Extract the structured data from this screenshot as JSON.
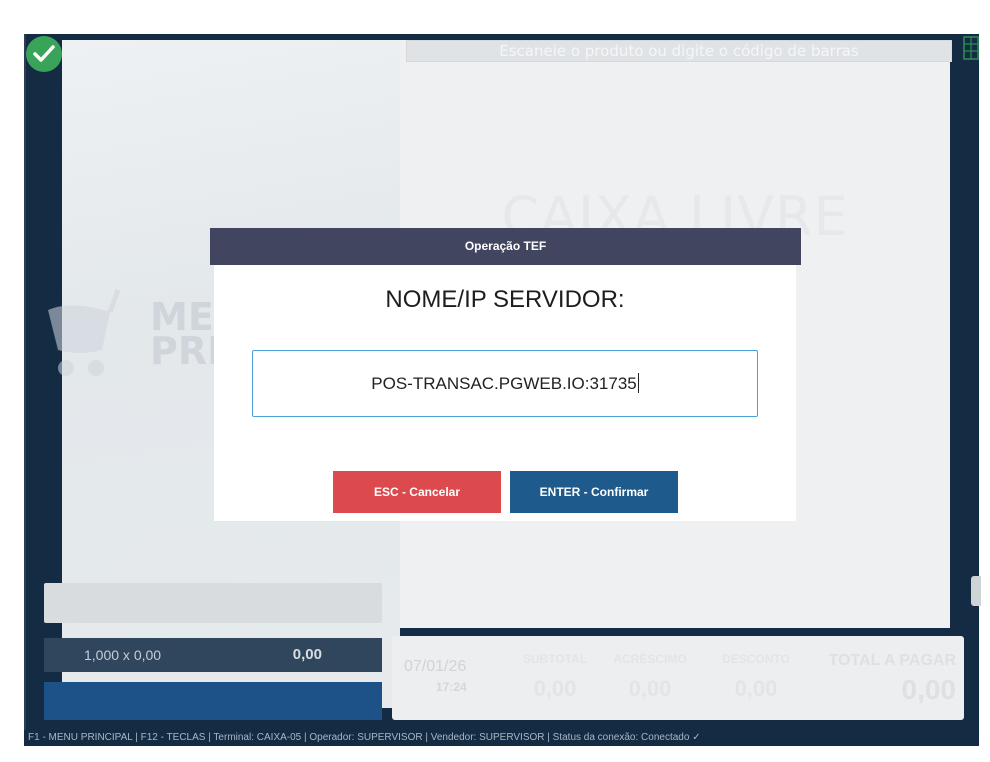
{
  "background": {
    "scan_placeholder": "Escaneie o produto ou digite o código de barras",
    "caixa_status": "CAIXA LIVRE",
    "logo_text_line1": "MEU",
    "logo_text_line2": "PRE",
    "left_row_qty": "1,000 x 0,00",
    "left_row_value": "0,00"
  },
  "totals": {
    "date": "07/01/26",
    "time": "17:24",
    "subtotal_label": "SUBTOTAL",
    "subtotal_value": "0,00",
    "acrescimo_label": "ACRÉSCIMO",
    "acrescimo_value": "0,00",
    "desconto_label": "DESCONTO",
    "desconto_value": "0,00",
    "total_label": "TOTAL A PAGAR",
    "total_value": "0,00"
  },
  "footer": {
    "text": "F1 - MENU PRINCIPAL | F12 - TECLAS | Terminal: CAIXA-05 | Operador: SUPERVISOR | Vendedor: SUPERVISOR | Status da conexão: Conectado ✓"
  },
  "modal": {
    "header": "Operação TEF",
    "title": "NOME/IP SERVIDOR:",
    "input_value": "POS-TRANSAC.PGWEB.IO:31735",
    "cancel_label": "ESC - Cancelar",
    "confirm_label": "ENTER - Confirmar"
  },
  "colors": {
    "modal_header_bg": "#424560",
    "cancel_bg": "#dc4a4d",
    "confirm_bg": "#1e5a8c",
    "input_border": "#4aa3d8",
    "status_green": "#3aa35a",
    "app_bg": "#142b44"
  },
  "icons": [
    "checkmark-icon",
    "grid-icon",
    "cart-logo-icon"
  ]
}
